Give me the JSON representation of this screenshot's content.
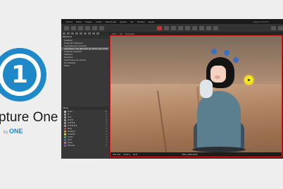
{
  "branding": {
    "logo_glyph": "1",
    "name": "pture One",
    "by_prefix": "by",
    "by_company": "ONE"
  },
  "app": {
    "menu": [
      "Archivo",
      "Editar",
      "Imagen",
      "Capas",
      "Seleccionar",
      "Ajustes",
      "Ver",
      "Ventana",
      "Ayuda"
    ],
    "window_title": "Capture One Pro",
    "left_panel": {
      "section1_title": "Biblioteca",
      "rows1": [
        {
          "label": "Catálogo",
          "count": ""
        },
        {
          "label": "Todas las imágenes",
          "count": ""
        },
        {
          "label": "Importaciones recientes",
          "count": ""
        },
        {
          "label": "Importado: 1 de diciembre de 2016 a las 13:32",
          "count": "",
          "selected": true
        },
        {
          "label": "Capturas recientes",
          "count": ""
        },
        {
          "label": "Papelera",
          "count": ""
        },
        {
          "label": "Favoritos",
          "count": ""
        },
        {
          "label": "Colecciones de usuario",
          "count": ""
        },
        {
          "label": "En Catálogo",
          "count": ""
        },
        {
          "label": "Filtros",
          "count": ""
        }
      ],
      "section2_title": "Filtros",
      "rows2": [
        {
          "label": "Todo",
          "count": "12",
          "color": "#bbbbbb"
        },
        {
          "label": "★",
          "count": "0",
          "color": "#999999"
        },
        {
          "label": "★★",
          "count": "0",
          "color": "#999999"
        },
        {
          "label": "★★★",
          "count": "0",
          "color": "#999999"
        },
        {
          "label": "★★★★",
          "count": "0",
          "color": "#999999"
        },
        {
          "label": "★★★★★",
          "count": "0",
          "color": "#999999"
        },
        {
          "label": "Rojo",
          "count": "0",
          "color": "#d23a3a"
        },
        {
          "label": "Naranja",
          "count": "0",
          "color": "#e08a2c"
        },
        {
          "label": "Amarillo",
          "count": "0",
          "color": "#d6c625"
        },
        {
          "label": "Verde",
          "count": "0",
          "color": "#3ca64a"
        },
        {
          "label": "Azul",
          "count": "0",
          "color": "#3b6fc4"
        },
        {
          "label": "Rosa",
          "count": "0",
          "color": "#d45fa8"
        },
        {
          "label": "Morado",
          "count": "0",
          "color": "#8a4fc0"
        }
      ]
    },
    "viewer": {
      "header_tabs": [
        "Filtro",
        "Ver",
        "Presentar"
      ],
      "footer_left": "ISO 100",
      "footer_left2": "1/100 s",
      "footer_left3": "f/2.8",
      "footer_center": "IMG_0095.ARW"
    }
  },
  "colors": {
    "accent": "#1e88c8",
    "border_highlight": "#d02020",
    "cursor_highlight": "#f5e61c"
  }
}
